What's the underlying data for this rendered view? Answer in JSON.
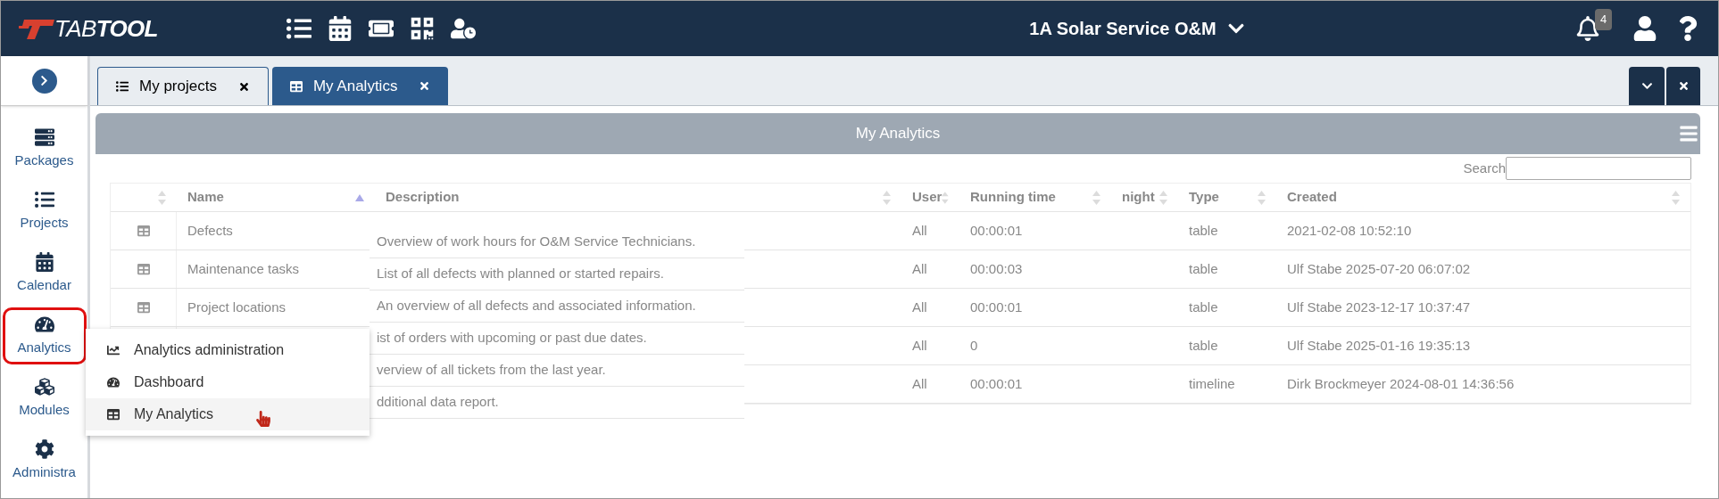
{
  "topbar": {
    "logo_light": "TAB",
    "logo_bold": "TOOL",
    "company": "1A Solar Service O&M",
    "notifications": "4"
  },
  "tabs": [
    {
      "label": "My projects",
      "kind": "list",
      "selected": false
    },
    {
      "label": "My Analytics",
      "kind": "table",
      "selected": true
    }
  ],
  "sidebar": {
    "items": [
      {
        "label": "Packages",
        "kind": "packages",
        "highlighted": false
      },
      {
        "label": "Projects",
        "kind": "projects",
        "highlighted": false
      },
      {
        "label": "Calendar",
        "kind": "calendar",
        "highlighted": false
      },
      {
        "label": "Analytics",
        "kind": "analytics",
        "highlighted": true
      },
      {
        "label": "Modules",
        "kind": "modules",
        "highlighted": false
      },
      {
        "label": "Administra",
        "kind": "admin",
        "highlighted": false
      }
    ]
  },
  "panel": {
    "title": "My Analytics",
    "search_label": "Search"
  },
  "table": {
    "columns": [
      {
        "sorted": false
      },
      {
        "label": "Name",
        "sorted": true
      },
      {
        "label": "Description",
        "sorted": false
      },
      {
        "label": "User",
        "sorted": false
      },
      {
        "label": "Running time",
        "sorted": false
      },
      {
        "label": "night",
        "sorted": false
      },
      {
        "label": "Type",
        "sorted": false
      },
      {
        "label": "Created",
        "sorted": false
      }
    ],
    "rows": [
      {
        "name": "Defects",
        "user": "All",
        "running_time": "00:00:01",
        "type": "table",
        "created": "2021-02-08 10:52:10"
      },
      {
        "name": "Maintenance tasks",
        "user": "All",
        "running_time": "00:00:03",
        "type": "table",
        "created": "Ulf Stabe 2025-07-20 06:07:02"
      },
      {
        "name": "Project locations",
        "user": "All",
        "running_time": "00:00:01",
        "type": "table",
        "created": "Ulf Stabe 2023-12-17 10:37:47"
      },
      {
        "user": "All",
        "running_time": "0",
        "type": "table",
        "created": "Ulf Stabe 2025-01-16 19:35:13"
      },
      {
        "user": "All",
        "running_time": "00:00:01",
        "type": "timeline",
        "created": "Dirk Brockmeyer 2024-08-01 14:36:56"
      }
    ]
  },
  "description_overlay": [
    "Overview of work hours for O&M Service Technicians.",
    "List of all defects with planned or started repairs.",
    "An overview of all defects and associated information.",
    "ist of orders with upcoming or past due dates.",
    "verview of all tickets from the last year.",
    "dditional data report."
  ],
  "menu": {
    "items": [
      {
        "label": "Analytics administration",
        "kind": "chart",
        "highlighted": false
      },
      {
        "label": "Dashboard",
        "kind": "dashboard",
        "highlighted": false
      },
      {
        "label": "My Analytics",
        "kind": "table",
        "highlighted": true
      }
    ]
  }
}
